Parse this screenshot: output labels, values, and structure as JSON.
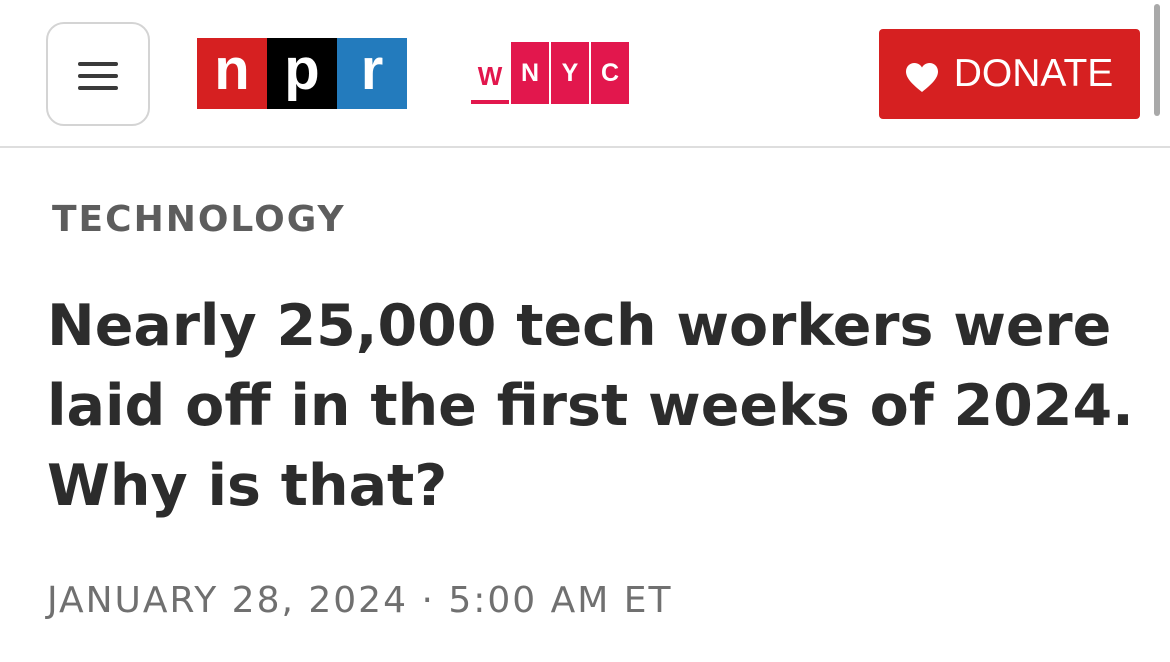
{
  "header": {
    "menu_icon": "hamburger-menu-icon",
    "npr_logo": {
      "letters": [
        "n",
        "p",
        "r"
      ],
      "colors": [
        "#d62021",
        "#000000",
        "#237bbd"
      ]
    },
    "wnyc_logo": {
      "letters": [
        "W",
        "N",
        "Y",
        "C"
      ],
      "color": "#e2174d"
    },
    "donate": {
      "icon": "heart-icon",
      "label": "DONATE",
      "color": "#d62021"
    }
  },
  "article": {
    "section": "TECHNOLOGY",
    "headline": "Nearly 25,000 tech workers were laid off in the first weeks of 2024. Why is that?",
    "date": "JANUARY 28, 2024",
    "separator": "·",
    "time": "5:00 AM ET"
  }
}
